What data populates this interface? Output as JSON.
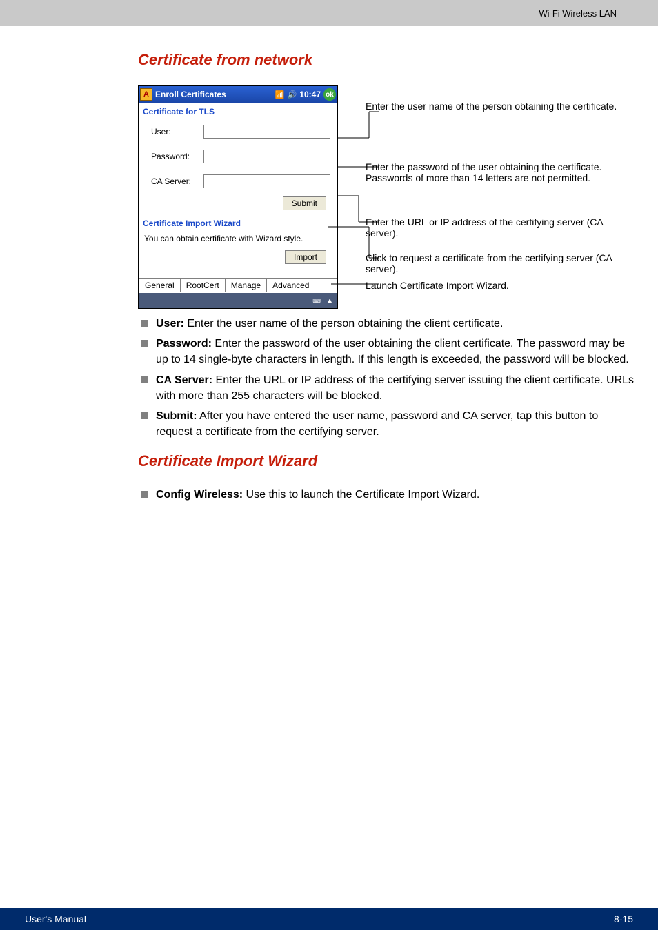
{
  "header": {
    "right": "Wi-Fi Wireless LAN"
  },
  "sections": {
    "cert_network_title": "Certificate from network",
    "cert_wizard_title": "Certificate Import Wizard"
  },
  "screenshot": {
    "titlebar": {
      "app_icon": "A",
      "title": "Enroll Certificates",
      "time": "10:47",
      "ok": "ok"
    },
    "panel1_title": "Certificate for TLS",
    "labels": {
      "user": "User:",
      "password": "Password:",
      "ca": "CA Server:"
    },
    "buttons": {
      "submit": "Submit",
      "import": "Import"
    },
    "panel2_title": "Certificate Import Wizard",
    "wizard_text": "You can obtain certificate with Wizard style.",
    "tabs": {
      "general": "General",
      "rootcert": "RootCert",
      "manage": "Manage",
      "advanced": "Advanced"
    }
  },
  "callouts": {
    "user": "Enter the user name of the person obtaining the certificate.",
    "password": "Enter the password of the user obtaining the certificate. Passwords of more than 14 letters are not permitted.",
    "ca": "Enter the URL or IP address of the certifying server (CA server).",
    "submit": "Click to request a certificate from the certifying server (CA server).",
    "import": "Launch Certificate Import Wizard."
  },
  "bullets_network": [
    {
      "label": "User:",
      "text": " Enter the user name of the person obtaining the client certificate."
    },
    {
      "label": "Password:",
      "text": " Enter the password of the user obtaining the client certificate. The password may be up to 14 single-byte characters in length. If this length is exceeded, the password will be blocked."
    },
    {
      "label": "CA Server:",
      "text": " Enter the URL or IP address of the certifying server issuing the client certificate. URLs with more than 255 characters will be blocked."
    },
    {
      "label": "Submit:",
      "text": " After you have entered the user name, password and CA server, tap this button to request a certificate from the certifying server."
    }
  ],
  "bullets_wizard": [
    {
      "label": "Config Wireless:",
      "text": " Use this to launch the Certificate Import Wizard."
    }
  ],
  "footer": {
    "left": "User's Manual",
    "right": "8-15"
  }
}
